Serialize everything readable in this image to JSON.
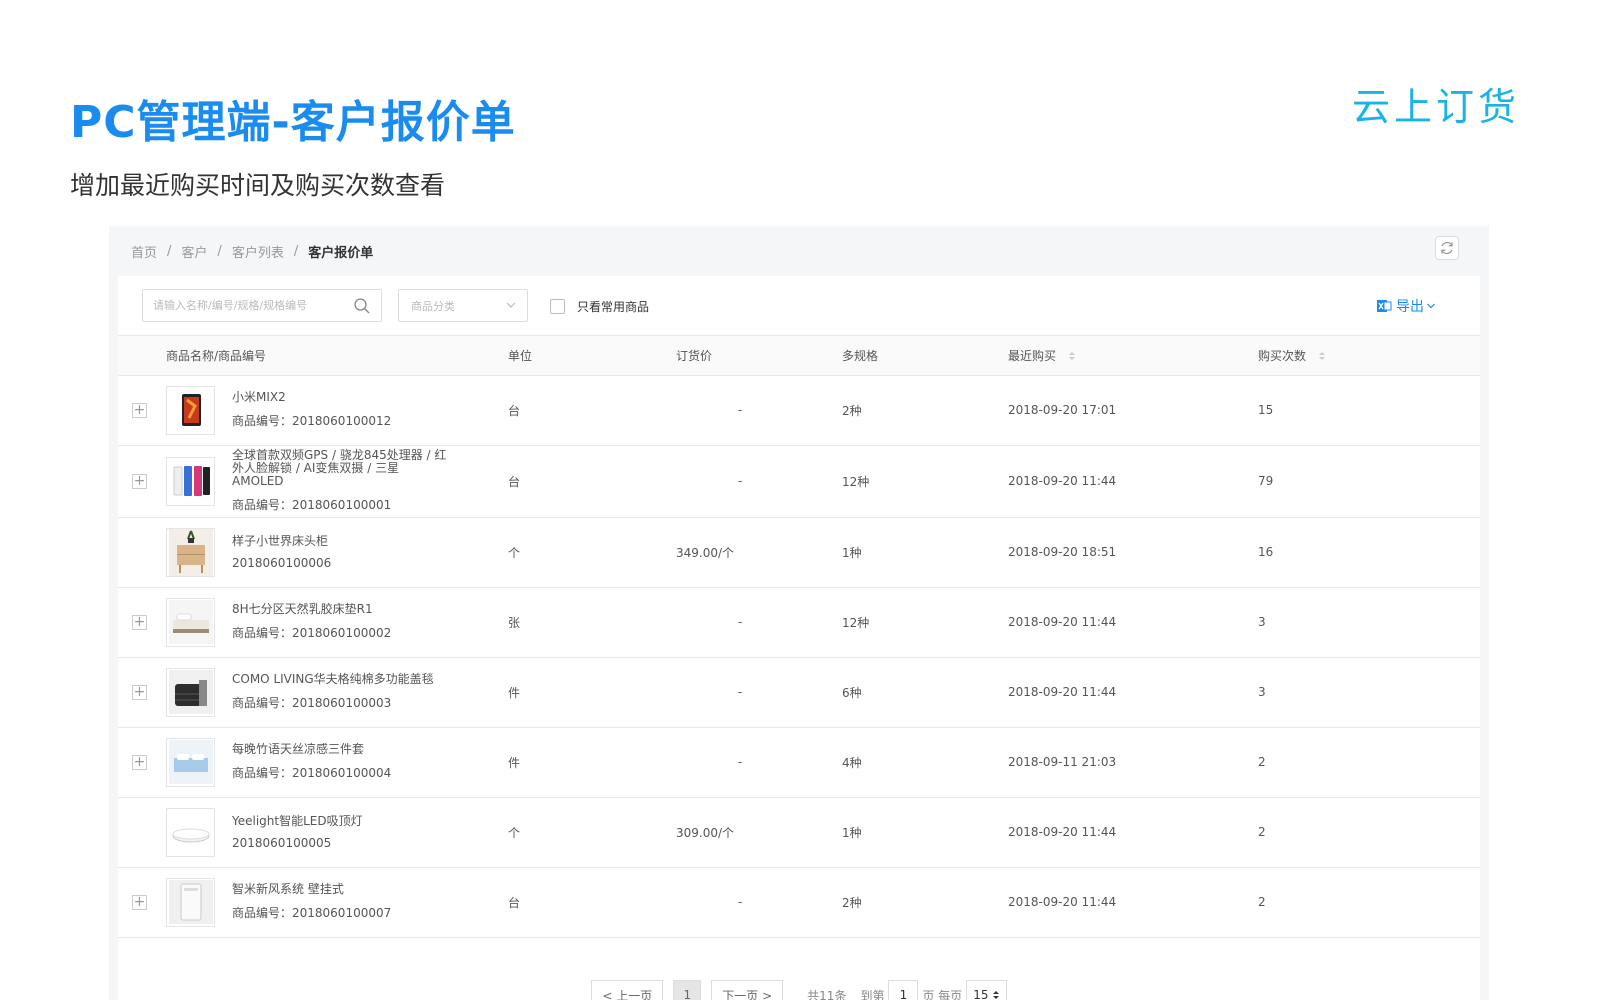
{
  "slide": {
    "title": "PC管理端-客户报价单",
    "subtitle": "增加最近购买时间及购买次数查看",
    "logo": "云上订货"
  },
  "breadcrumb": [
    "首页",
    "客户",
    "客户列表",
    "客户报价单"
  ],
  "breadcrumb_sep": "/",
  "toolbar": {
    "search_placeholder": "请输入名称/编号/规格/规格编号",
    "category_placeholder": "商品分类",
    "only_common_label": "只看常用商品",
    "export_label": "导出"
  },
  "table": {
    "headers": {
      "name": "商品名称/商品编号",
      "unit": "单位",
      "price": "订货价",
      "spec": "多规格",
      "recent": "最近购买",
      "count": "购买次数"
    },
    "rows": [
      {
        "name": "小米MIX2",
        "code": "商品编号：2018060100012",
        "unit": "台",
        "price": "-",
        "spec": "2种",
        "recent": "2018-09-20 17:01",
        "count": "15",
        "expandable": true,
        "thumb": "phone-dark"
      },
      {
        "name": "全球首款双频GPS / 骁龙845处理器 / 红外人脸解锁 / AI变焦双摄 / 三星 AMOLED",
        "code": "商品编号：2018060100001",
        "unit": "台",
        "price": "-",
        "spec": "12种",
        "recent": "2018-09-20 11:44",
        "count": "79",
        "expandable": true,
        "thumb": "phones-color"
      },
      {
        "name": "样子小世界床头柜",
        "code": "2018060100006",
        "unit": "个",
        "price": "349.00/个",
        "spec": "1种",
        "recent": "2018-09-20 18:51",
        "count": "16",
        "expandable": false,
        "thumb": "nightstand"
      },
      {
        "name": "8H七分区天然乳胶床垫R1",
        "code": "商品编号：2018060100002",
        "unit": "张",
        "price": "-",
        "spec": "12种",
        "recent": "2018-09-20 11:44",
        "count": "3",
        "expandable": true,
        "thumb": "bed"
      },
      {
        "name": "COMO LIVING华夫格纯棉多功能盖毯",
        "code": "商品编号：2018060100003",
        "unit": "件",
        "price": "-",
        "spec": "6种",
        "recent": "2018-09-20 11:44",
        "count": "3",
        "expandable": true,
        "thumb": "blanket"
      },
      {
        "name": "每晚竹语天丝凉感三件套",
        "code": "商品编号：2018060100004",
        "unit": "件",
        "price": "-",
        "spec": "4种",
        "recent": "2018-09-11 21:03",
        "count": "2",
        "expandable": true,
        "thumb": "bedding"
      },
      {
        "name": "Yeelight智能LED吸顶灯",
        "code": "2018060100005",
        "unit": "个",
        "price": "309.00/个",
        "spec": "1种",
        "recent": "2018-09-20 11:44",
        "count": "2",
        "expandable": false,
        "thumb": "lamp"
      },
      {
        "name": "智米新风系统 壁挂式",
        "code": "商品编号：2018060100007",
        "unit": "台",
        "price": "-",
        "spec": "2种",
        "recent": "2018-09-20 11:44",
        "count": "2",
        "expandable": true,
        "thumb": "air-unit"
      }
    ]
  },
  "pager": {
    "prev": "< 上一页",
    "current": "1",
    "next": "下一页 >",
    "total": "共11条",
    "goto_label": "到第",
    "goto_value": "1",
    "page_per": "页 每页",
    "page_size": "15"
  },
  "colors": {
    "accent": "#1a8cf0",
    "logo": "#1ab3e6"
  }
}
